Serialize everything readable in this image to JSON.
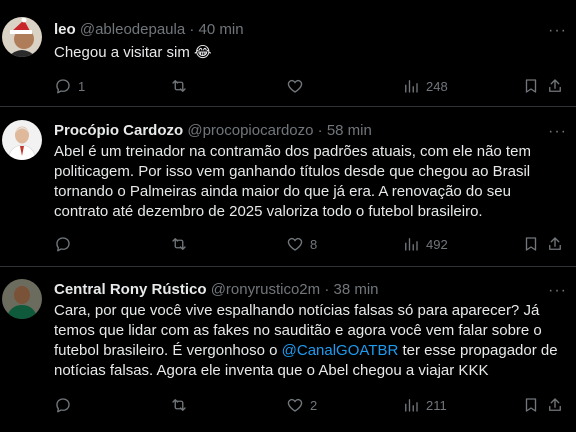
{
  "tweets": [
    {
      "name": "leo",
      "handle": "@ableodepaula",
      "time": "40 min",
      "dot": "·",
      "body": "Chegou a visitar sim 😂",
      "replies": "1",
      "retweets": "",
      "likes": "",
      "views": "248"
    },
    {
      "name": "Procópio Cardozo",
      "handle": "@procopiocardozo",
      "time": "58 min",
      "dot": "·",
      "body": "Abel é um treinador na contramão dos padrões atuais, com ele não tem politicagem. Por isso vem ganhando títulos desde que chegou ao Brasil tornando o Palmeiras ainda maior do que já era. A renovação do seu contrato até dezembro de 2025 valoriza todo o futebol brasileiro.",
      "replies": "",
      "retweets": "",
      "likes": "8",
      "views": "492"
    },
    {
      "name": "Central Rony Rústico",
      "handle": "@ronyrustico2m",
      "time": "38 min",
      "dot": "·",
      "body_before": "Cara, por que você vive espalhando notícias falsas só para aparecer? Já temos que lidar com as fakes no sauditão e agora você vem falar sobre o futebol brasileiro. É vergonhoso o ",
      "mention": "@CanalGOATBR",
      "body_after": " ter esse propagador de notícias falsas. Agora ele inventa que o Abel chegou a viajar KKK",
      "replies": "",
      "retweets": "",
      "likes": "2",
      "views": "211"
    }
  ],
  "icons": {
    "reply": "reply-icon",
    "retweet": "retweet-icon",
    "like": "heart-icon",
    "views": "views-icon",
    "bookmark": "bookmark-icon",
    "share": "share-icon",
    "more": "more-icon"
  },
  "colors": {
    "background": "#000000",
    "text": "#e7e9ea",
    "muted": "#71767b",
    "link": "#1d9bf0",
    "divider": "#2f3336"
  }
}
